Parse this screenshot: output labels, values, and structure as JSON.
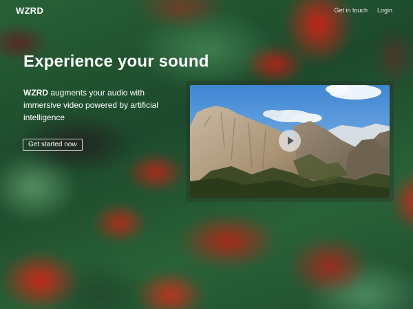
{
  "header": {
    "logo": "WZRD",
    "nav": [
      {
        "label": "Get in touch"
      },
      {
        "label": "Login"
      }
    ]
  },
  "hero": {
    "title": "Experience your sound",
    "description_brand": "WZRD",
    "description_rest": " augments your audio with immersive video powered by artificial intelligence",
    "cta_label": "Get started now"
  },
  "video": {
    "play_icon": "play-icon"
  },
  "colors": {
    "text": "#ffffff",
    "background_green": "#1e5a32",
    "background_red": "#e02a1e"
  }
}
